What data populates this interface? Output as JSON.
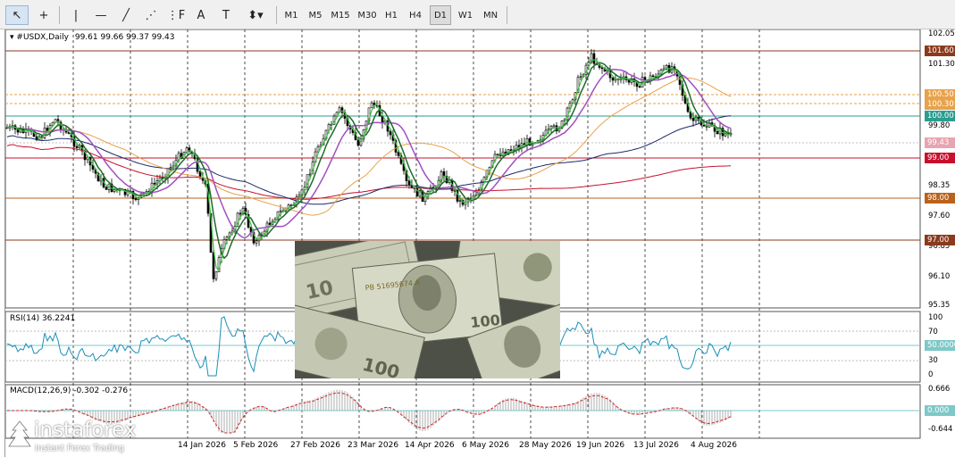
{
  "toolbar": {
    "tools": [
      {
        "name": "cursor-tool",
        "glyph": "↖"
      },
      {
        "name": "crosshair-tool",
        "glyph": "+"
      },
      {
        "name": "vertical-line-tool",
        "glyph": "|"
      },
      {
        "name": "horizontal-line-tool",
        "glyph": "—"
      },
      {
        "name": "trendline-tool",
        "glyph": "╱"
      },
      {
        "name": "channel-tool",
        "glyph": "⋰"
      },
      {
        "name": "fibonacci-tool",
        "glyph": "⋮F"
      },
      {
        "name": "text-tool",
        "glyph": "A"
      },
      {
        "name": "text-label-tool",
        "glyph": "T"
      },
      {
        "name": "arrow-shapes-tool",
        "glyph": "⬍▾"
      }
    ],
    "timeframes": [
      "M1",
      "M5",
      "M15",
      "M30",
      "H1",
      "H4",
      "D1",
      "W1",
      "MN"
    ],
    "active_timeframe": "D1"
  },
  "chart": {
    "title": "#USDX,Daily",
    "ohlc": "99.61 99.66 99.37 99.43",
    "price_axis": [
      "102.05",
      "101.30",
      "99.80",
      "98.35",
      "97.60",
      "96.85",
      "96.10",
      "95.35"
    ],
    "price_tags": [
      {
        "value": "101.60",
        "color": "#8b3a1e"
      },
      {
        "value": "100.50",
        "color": "#e8a24a"
      },
      {
        "value": "100.30",
        "color": "#e8a24a"
      },
      {
        "value": "100.00",
        "color": "#2a9d8f"
      },
      {
        "value": "99.43",
        "color": "#e6a5b0"
      },
      {
        "value": "99.00",
        "color": "#c8102e"
      },
      {
        "value": "98.00",
        "color": "#b8621b"
      },
      {
        "value": "97.00",
        "color": "#8b3a1e"
      }
    ],
    "date_axis": [
      "14 Jan 2026",
      "5 Feb 2026",
      "27 Feb 2026",
      "23 Mar 2026",
      "14 Apr 2026",
      "6 May 2026",
      "28 May 2026",
      "19 Jun 2026",
      "13 Jul 2026",
      "4 Aug 2026"
    ]
  },
  "rsi": {
    "label": "RSI(14) 36.2241",
    "axis": [
      "100",
      "70",
      "30",
      "0"
    ],
    "level_tag": "50.0000"
  },
  "macd": {
    "label": "MACD(12,26,9) -0.302 -0.276",
    "axis": [
      "0.666",
      "-0.644"
    ],
    "zero_tag": "0.000"
  },
  "watermark": {
    "name": "instaforex",
    "tagline": "Instant Forex Trading"
  },
  "photo": {
    "banknote_serial": "PB 51695674 A"
  }
}
